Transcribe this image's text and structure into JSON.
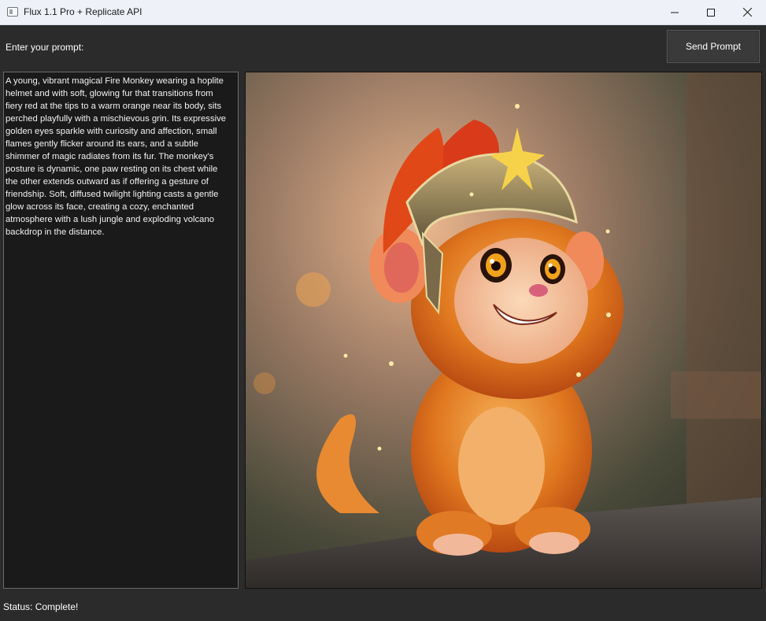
{
  "window": {
    "title": "Flux 1.1 Pro + Replicate API",
    "icons": {
      "app": "app-window-icon",
      "minimize": "minimize-icon",
      "maximize": "maximize-icon",
      "close": "close-icon"
    }
  },
  "form": {
    "prompt_label": "Enter your prompt:",
    "send_button_label": "Send Prompt",
    "prompt_value": "A young, vibrant magical Fire Monkey wearing a hoplite\nhelmet and with soft, glowing fur that transitions from\nfiery red at the tips to a warm orange near its body, sits\nperched playfully with a mischievous grin. Its expressive\ngolden eyes sparkle with curiosity and affection, small\nflames gently flicker around its ears, and a subtle\nshimmer of magic radiates from its fur. The monkey's\nposture is dynamic, one paw resting on its chest while\nthe other extends outward as if offering a gesture of\nfriendship. Soft, diffused twilight lighting casts a gentle\nglow across its face, creating a cozy, enchanted\natmosphere with a lush jungle and exploding volcano\nbackdrop in the distance."
  },
  "status": {
    "text": "Status: Complete!"
  },
  "colors": {
    "background": "#2b2b2b",
    "textarea_bg": "#1a1a1a",
    "titlebar_bg": "#eef2f8"
  }
}
